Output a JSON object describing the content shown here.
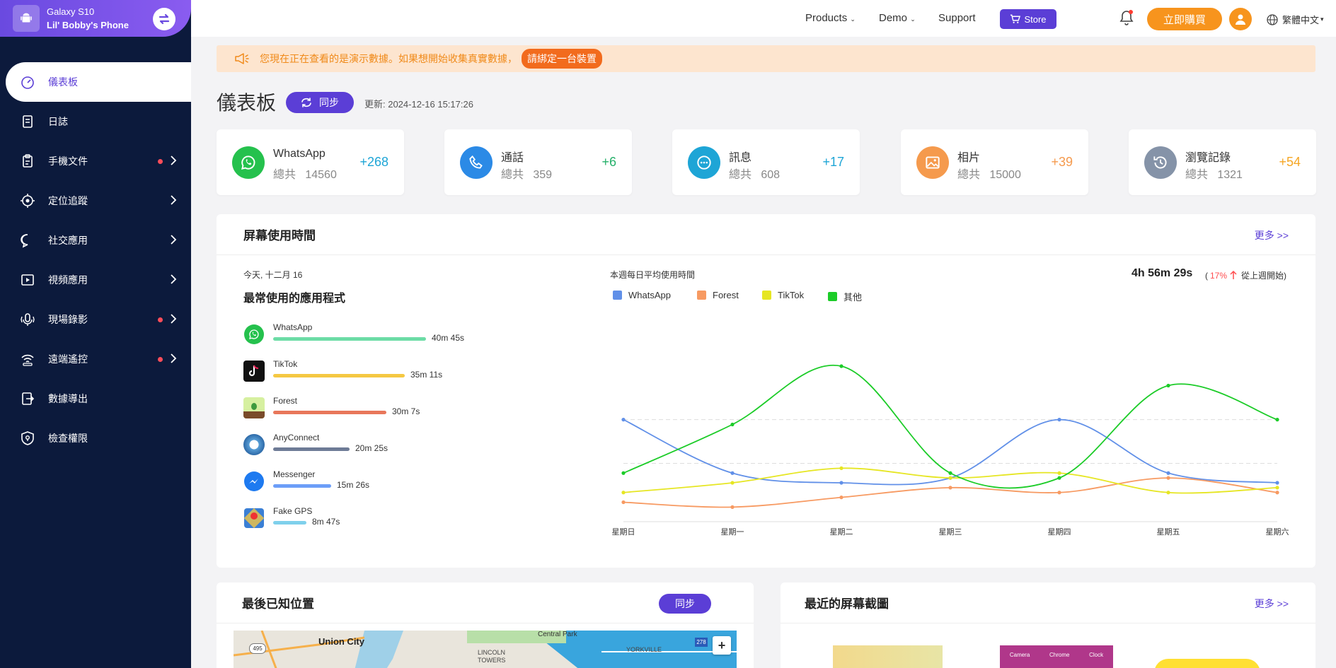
{
  "device": {
    "model": "Galaxy S10",
    "name": "Lil' Bobby's Phone"
  },
  "sidebar": {
    "items": [
      {
        "label": "儀表板",
        "icon": "dashboard-icon",
        "active": true,
        "dot": false,
        "chevron": false
      },
      {
        "label": "日誌",
        "icon": "log-icon",
        "active": false,
        "dot": false,
        "chevron": false
      },
      {
        "label": "手機文件",
        "icon": "clipboard-icon",
        "active": false,
        "dot": true,
        "chevron": true
      },
      {
        "label": "定位追蹤",
        "icon": "location-icon",
        "active": false,
        "dot": false,
        "chevron": true
      },
      {
        "label": "社交應用",
        "icon": "chat-icon",
        "active": false,
        "dot": false,
        "chevron": true
      },
      {
        "label": "視頻應用",
        "icon": "video-icon",
        "active": false,
        "dot": false,
        "chevron": true
      },
      {
        "label": "現場錄影",
        "icon": "live-record-icon",
        "active": false,
        "dot": true,
        "chevron": true
      },
      {
        "label": "遠端遙控",
        "icon": "remote-icon",
        "active": false,
        "dot": true,
        "chevron": true
      },
      {
        "label": "數據導出",
        "icon": "export-icon",
        "active": false,
        "dot": false,
        "chevron": false
      },
      {
        "label": "檢查權限",
        "icon": "permission-icon",
        "active": false,
        "dot": false,
        "chevron": false
      }
    ]
  },
  "topnav": {
    "products": "Products",
    "demo": "Demo",
    "support": "Support",
    "store": "Store",
    "buy": "立即購買",
    "lang": "繁體中文"
  },
  "notice": {
    "text": "您現在正在查看的是演示數據。如果想開始收集真實數據，",
    "button": "請綁定一台裝置"
  },
  "header": {
    "title": "儀表板",
    "sync": "同步",
    "updated": "更新:   2024-12-16 15:17:26"
  },
  "stats": [
    {
      "name": "WhatsApp",
      "total_label": "總共",
      "total": "14560",
      "delta": "+268",
      "color": "#25c14d",
      "delta_color": "#1ea5d6",
      "icon": "whatsapp-icon"
    },
    {
      "name": "通話",
      "total_label": "總共",
      "total": "359",
      "delta": "+6",
      "color": "#2b8ae6",
      "delta_color": "#25b06a",
      "icon": "phone-icon"
    },
    {
      "name": "訊息",
      "total_label": "總共",
      "total": "608",
      "delta": "+17",
      "color": "#1ea5d6",
      "delta_color": "#1ea5d6",
      "icon": "message-icon"
    },
    {
      "name": "相片",
      "total_label": "總共",
      "total": "15000",
      "delta": "+39",
      "color": "#f59a4d",
      "delta_color": "#f59a4d",
      "icon": "photo-icon"
    },
    {
      "name": "瀏覽記錄",
      "total_label": "總共",
      "total": "1321",
      "delta": "+54",
      "color": "#8593a8",
      "delta_color": "#f5a623",
      "icon": "history-icon"
    }
  ],
  "screen_time": {
    "title": "屏幕使用時間",
    "more": "更多 >>",
    "date": "今天, 十二月 16",
    "apps_title": "最常使用的應用程式",
    "apps": [
      {
        "name": "WhatsApp",
        "time": "40m 45s",
        "minutes": 40.75,
        "color": "#6cdca6",
        "icon": "whatsapp-icon"
      },
      {
        "name": "TikTok",
        "time": "35m 11s",
        "minutes": 35.18,
        "color": "#f5c842",
        "icon": "tiktok-icon"
      },
      {
        "name": "Forest",
        "time": "30m 7s",
        "minutes": 30.12,
        "color": "#e8775b",
        "icon": "forest-icon"
      },
      {
        "name": "AnyConnect",
        "time": "20m 25s",
        "minutes": 20.42,
        "color": "#6e7b96",
        "icon": "anyconnect-icon"
      },
      {
        "name": "Messenger",
        "time": "15m 26s",
        "minutes": 15.43,
        "color": "#6c9ef8",
        "icon": "messenger-icon"
      },
      {
        "name": "Fake GPS",
        "time": "8m 47s",
        "minutes": 8.78,
        "color": "#7fd0ec",
        "icon": "fake-gps-icon"
      }
    ],
    "avg_label": "本週每日平均使用時間",
    "avg_value": "4h 56m 29s",
    "change_pre": "(",
    "change_pct": "17%",
    "change_post": "從上週開始)"
  },
  "chart_data": {
    "type": "line",
    "categories": [
      "星期日",
      "星期一",
      "星期二",
      "星期三",
      "星期四",
      "星期五",
      "星期六"
    ],
    "ylim": [
      0,
      160
    ],
    "series": [
      {
        "name": "WhatsApp",
        "color": "#6190e8",
        "values": [
          105,
          50,
          40,
          45,
          105,
          50,
          40
        ]
      },
      {
        "name": "Forest",
        "color": "#f79a62",
        "values": [
          20,
          15,
          25,
          35,
          30,
          45,
          30
        ]
      },
      {
        "name": "TikTok",
        "color": "#e6e623",
        "values": [
          30,
          40,
          55,
          45,
          50,
          30,
          35
        ]
      },
      {
        "name": "其他",
        "color": "#1ccc28",
        "values": [
          50,
          100,
          160,
          50,
          45,
          140,
          105
        ]
      }
    ]
  },
  "location": {
    "title": "最後已知位置",
    "sync": "同步",
    "map_labels": [
      "Union City",
      "Central Park",
      "LINCOLN TOWERS",
      "YORKVILLE",
      "495",
      "278"
    ]
  },
  "screenshots": {
    "title": "最近的屏幕截圖",
    "more": "更多 >>",
    "thumb_labels": [
      "Camera",
      "Chrome",
      "Clock"
    ]
  }
}
